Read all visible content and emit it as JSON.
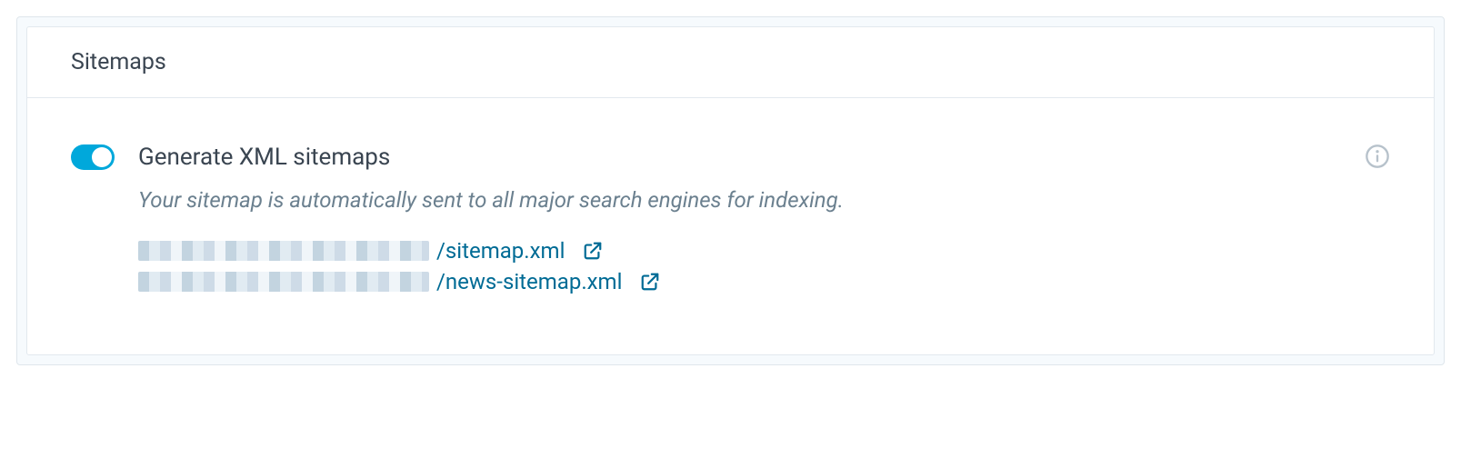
{
  "card": {
    "title": "Sitemaps"
  },
  "setting": {
    "toggle_on": true,
    "label": "Generate XML sitemaps",
    "description": "Your sitemap is automatically sent to all major search engines for indexing."
  },
  "links": [
    {
      "path": "/sitemap.xml"
    },
    {
      "path": "/news-sitemap.xml"
    }
  ],
  "icons": {
    "info": "info-icon",
    "external": "external-link-icon"
  },
  "colors": {
    "accent": "#00a8db",
    "link": "#006b95",
    "muted": "#6b808f"
  }
}
